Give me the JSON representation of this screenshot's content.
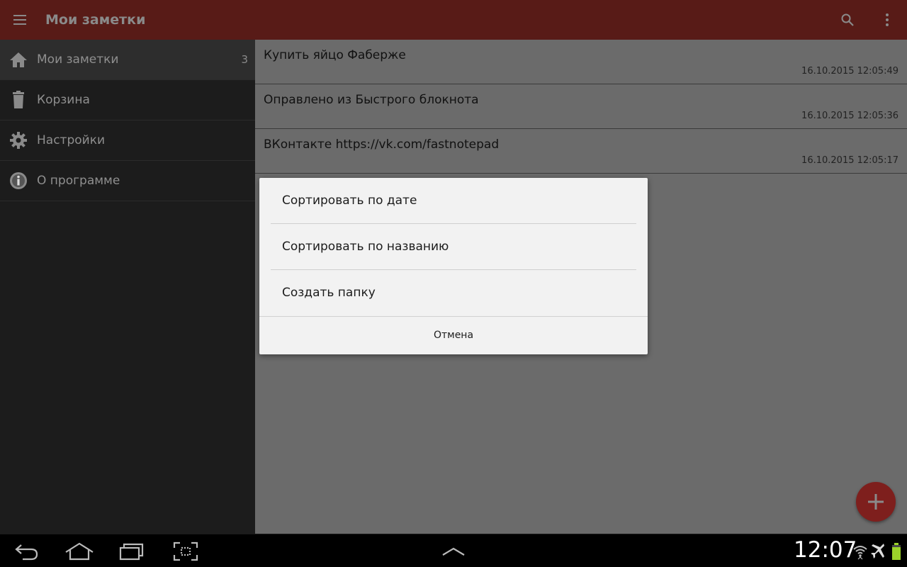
{
  "appbar": {
    "title": "Мои заметки"
  },
  "drawer": {
    "items": [
      {
        "label": "Мои заметки",
        "count": "3",
        "icon": "home-icon"
      },
      {
        "label": "Корзина",
        "icon": "trash-icon"
      },
      {
        "label": "Настройки",
        "icon": "gear-icon"
      },
      {
        "label": "О программе",
        "icon": "info-icon"
      }
    ]
  },
  "notes": [
    {
      "title": "Купить яйцо Фаберже",
      "date": "16.10.2015 12:05:49"
    },
    {
      "title": "Оправлено из Быстрого блокнота",
      "date": "16.10.2015 12:05:36"
    },
    {
      "title": "ВКонтакте https://vk.com/fastnotepad",
      "date": "16.10.2015 12:05:17"
    }
  ],
  "dialog": {
    "options": [
      "Сортировать по дате",
      "Сортировать по названию",
      "Создать папку"
    ],
    "cancel": "Отмена"
  },
  "statusbar": {
    "time": "12:07"
  },
  "colors": {
    "appbar": "#581b17",
    "fab": "#7e1f1d",
    "battery": "#9bd22a"
  }
}
